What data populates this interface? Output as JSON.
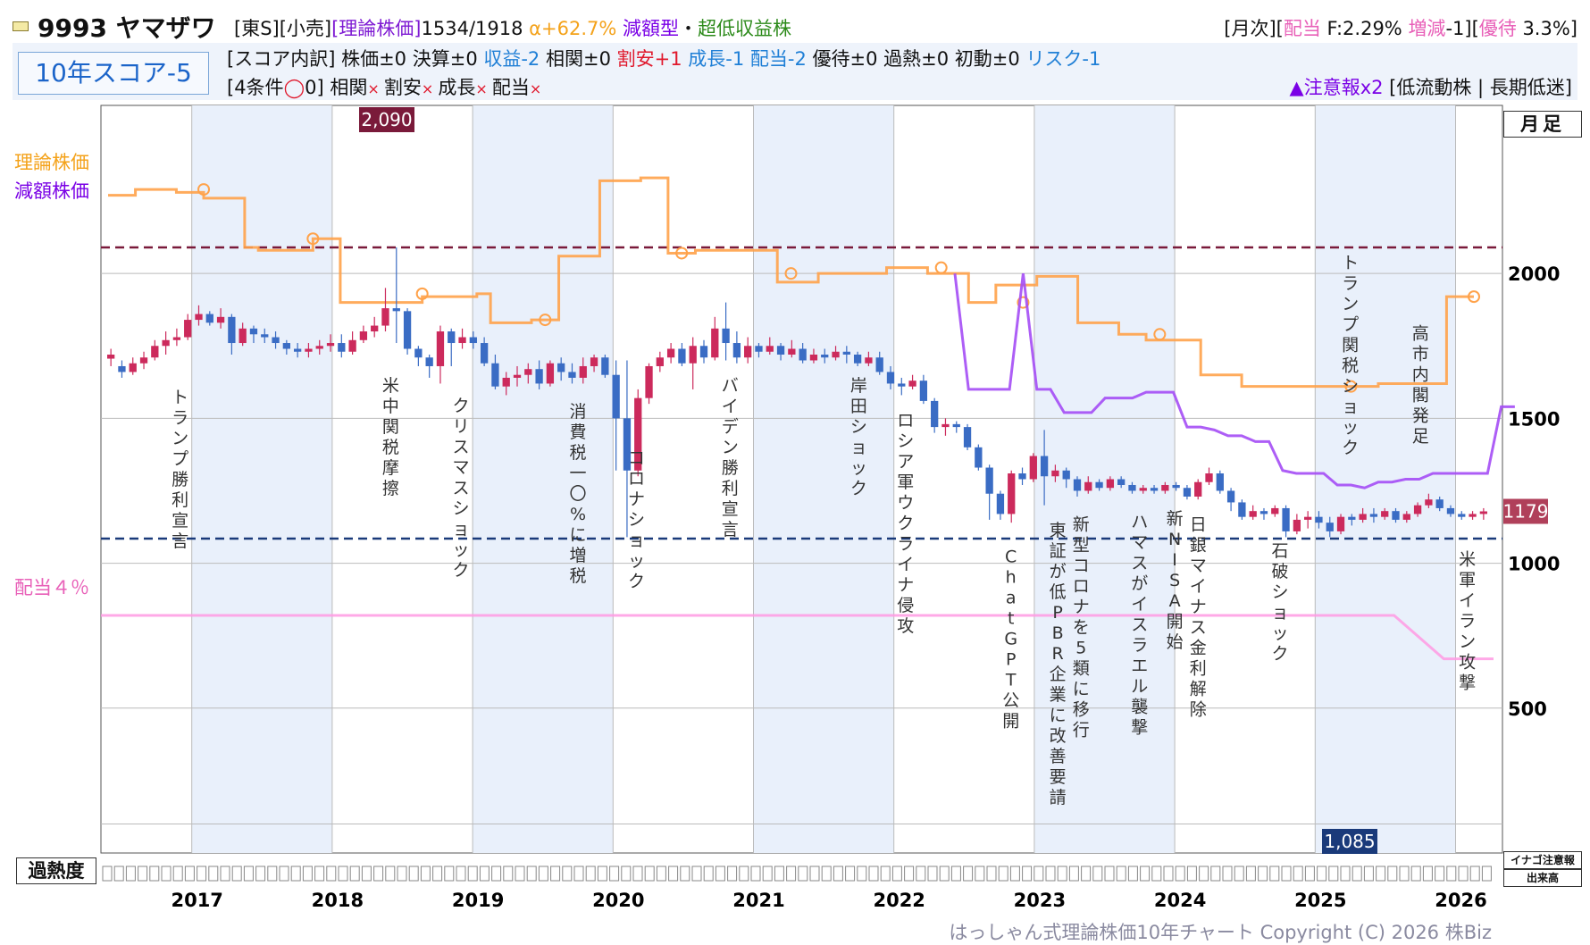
{
  "header": {
    "code_name": "9993 ヤマザワ",
    "market": "[東S][小売]",
    "theory_label": "[理論株価]",
    "theory_values": "1534/1918",
    "alpha": "α+62.7%",
    "type": "減額型",
    "dot": "・",
    "class": "超低収益株",
    "right_prefix": "[月次][",
    "right_div_label": "配当",
    "right_div_val": " F:2.29% ",
    "right_chg_label": "増減",
    "right_chg_val": "-1][",
    "right_yutai_label": "優待",
    "right_yutai_val": " 3.3%]"
  },
  "score": {
    "box": "10年スコア-5",
    "breakdown_label": "[スコア内訳]",
    "items": [
      {
        "label": "株価±0",
        "color": "normal"
      },
      {
        "label": "決算±0",
        "color": "normal"
      },
      {
        "label": "収益-2",
        "color": "blue"
      },
      {
        "label": "相関±0",
        "color": "normal"
      },
      {
        "label": "割安+1",
        "color": "red"
      },
      {
        "label": "成長-1",
        "color": "blue"
      },
      {
        "label": "配当-2",
        "color": "blue"
      },
      {
        "label": "優待±0",
        "color": "normal"
      },
      {
        "label": "過熱±0",
        "color": "normal"
      },
      {
        "label": "初動±0",
        "color": "normal"
      },
      {
        "label": "リスク-1",
        "color": "blue"
      }
    ],
    "conditions_prefix": "[4条件",
    "conditions_circle": "◯",
    "conditions_count": "0]",
    "conditions": [
      "相関",
      "割安",
      "成長",
      "配当"
    ],
    "cross": "×",
    "warn_mark": "▲注意報x2",
    "warn_detail": " [低流動株 | 長期低迷]"
  },
  "labels": {
    "theory": "理論株価",
    "gengaku": "減額株価",
    "dividend": "配当４％",
    "kanetsu": "過熱度",
    "getsuashi": "月足",
    "inago": "イナゴ注意報",
    "dekidaka": "出来高",
    "copyright": "はっしゃん式理論株価10年チャート Copyright (C) 2026 株Biz",
    "high_badge": "2,090",
    "low_badge": "1,085",
    "last_badge": "1179"
  },
  "colors": {
    "theory": "#ffa24a",
    "gengaku": "#a44df5",
    "dividend": "#ff9ae3",
    "up": "#cc2a5c",
    "down": "#3a6cc4",
    "high_line": "#7a1a3a",
    "low_line": "#1a3a7a",
    "band": "#e9f0fb"
  },
  "chart_data": {
    "type": "candlestick",
    "x_ticks": [
      "2017",
      "2018",
      "2019",
      "2020",
      "2021",
      "2022",
      "2023",
      "2024",
      "2025",
      "2026"
    ],
    "y_ticks": [
      500,
      1000,
      1500,
      2000
    ],
    "ylim": [
      0,
      2580
    ],
    "high": 2090,
    "low": 1085,
    "last": 1179,
    "candles": [
      [
        1706,
        1720,
        1680,
        1740
      ],
      [
        1680,
        1660,
        1640,
        1700
      ],
      [
        1660,
        1690,
        1650,
        1710
      ],
      [
        1690,
        1710,
        1670,
        1730
      ],
      [
        1710,
        1750,
        1700,
        1770
      ],
      [
        1750,
        1770,
        1720,
        1800
      ],
      [
        1770,
        1780,
        1750,
        1810
      ],
      [
        1780,
        1840,
        1770,
        1860
      ],
      [
        1840,
        1860,
        1820,
        1890
      ],
      [
        1860,
        1830,
        1820,
        1870
      ],
      [
        1830,
        1850,
        1810,
        1880
      ],
      [
        1850,
        1760,
        1720,
        1860
      ],
      [
        1760,
        1810,
        1750,
        1830
      ],
      [
        1810,
        1790,
        1760,
        1820
      ],
      [
        1790,
        1780,
        1760,
        1810
      ],
      [
        1780,
        1760,
        1740,
        1800
      ],
      [
        1760,
        1740,
        1720,
        1770
      ],
      [
        1740,
        1730,
        1710,
        1760
      ],
      [
        1730,
        1740,
        1710,
        1760
      ],
      [
        1740,
        1750,
        1720,
        1770
      ],
      [
        1750,
        1760,
        1730,
        1790
      ],
      [
        1760,
        1730,
        1710,
        1790
      ],
      [
        1730,
        1770,
        1720,
        1800
      ],
      [
        1770,
        1800,
        1760,
        1820
      ],
      [
        1800,
        1820,
        1780,
        1850
      ],
      [
        1820,
        1880,
        1800,
        1950
      ],
      [
        1880,
        1870,
        1760,
        2090
      ],
      [
        1870,
        1740,
        1720,
        1880
      ],
      [
        1740,
        1710,
        1680,
        1750
      ],
      [
        1710,
        1680,
        1640,
        1720
      ],
      [
        1680,
        1800,
        1620,
        1820
      ],
      [
        1800,
        1760,
        1680,
        1810
      ],
      [
        1760,
        1780,
        1740,
        1810
      ],
      [
        1780,
        1760,
        1740,
        1800
      ],
      [
        1760,
        1690,
        1680,
        1780
      ],
      [
        1690,
        1610,
        1600,
        1720
      ],
      [
        1610,
        1640,
        1580,
        1660
      ],
      [
        1640,
        1650,
        1610,
        1680
      ],
      [
        1650,
        1670,
        1620,
        1690
      ],
      [
        1670,
        1620,
        1600,
        1700
      ],
      [
        1620,
        1690,
        1610,
        1700
      ],
      [
        1690,
        1660,
        1630,
        1710
      ],
      [
        1660,
        1640,
        1620,
        1690
      ],
      [
        1640,
        1680,
        1620,
        1710
      ],
      [
        1680,
        1710,
        1660,
        1720
      ],
      [
        1710,
        1650,
        1640,
        1720
      ],
      [
        1650,
        1500,
        1320,
        1700
      ],
      [
        1500,
        1320,
        1090,
        1700
      ],
      [
        1320,
        1570,
        1300,
        1600
      ],
      [
        1570,
        1680,
        1550,
        1690
      ],
      [
        1680,
        1710,
        1660,
        1730
      ],
      [
        1710,
        1740,
        1690,
        1760
      ],
      [
        1740,
        1690,
        1680,
        1760
      ],
      [
        1690,
        1750,
        1600,
        1780
      ],
      [
        1750,
        1710,
        1690,
        1770
      ],
      [
        1710,
        1810,
        1700,
        1850
      ],
      [
        1810,
        1760,
        1700,
        1900
      ],
      [
        1760,
        1710,
        1690,
        1800
      ],
      [
        1710,
        1750,
        1690,
        1780
      ],
      [
        1750,
        1730,
        1710,
        1760
      ],
      [
        1730,
        1750,
        1720,
        1780
      ],
      [
        1750,
        1720,
        1700,
        1760
      ],
      [
        1720,
        1740,
        1710,
        1770
      ],
      [
        1740,
        1700,
        1690,
        1760
      ],
      [
        1700,
        1720,
        1690,
        1740
      ],
      [
        1720,
        1710,
        1690,
        1740
      ],
      [
        1710,
        1730,
        1700,
        1750
      ],
      [
        1730,
        1720,
        1690,
        1750
      ],
      [
        1720,
        1690,
        1680,
        1730
      ],
      [
        1690,
        1710,
        1680,
        1730
      ],
      [
        1710,
        1660,
        1650,
        1730
      ],
      [
        1660,
        1620,
        1600,
        1680
      ],
      [
        1620,
        1610,
        1580,
        1640
      ],
      [
        1610,
        1630,
        1600,
        1650
      ],
      [
        1630,
        1560,
        1550,
        1650
      ],
      [
        1560,
        1470,
        1450,
        1570
      ],
      [
        1470,
        1480,
        1440,
        1500
      ],
      [
        1480,
        1470,
        1450,
        1490
      ],
      [
        1470,
        1400,
        1390,
        1480
      ],
      [
        1400,
        1330,
        1320,
        1410
      ],
      [
        1330,
        1240,
        1150,
        1340
      ],
      [
        1240,
        1170,
        1150,
        1250
      ],
      [
        1170,
        1310,
        1140,
        1320
      ],
      [
        1310,
        1290,
        1270,
        1330
      ],
      [
        1290,
        1370,
        1280,
        1380
      ],
      [
        1370,
        1300,
        1200,
        1460
      ],
      [
        1300,
        1320,
        1280,
        1340
      ],
      [
        1320,
        1290,
        1260,
        1330
      ],
      [
        1290,
        1250,
        1230,
        1300
      ],
      [
        1250,
        1280,
        1240,
        1300
      ],
      [
        1280,
        1260,
        1250,
        1290
      ],
      [
        1260,
        1290,
        1250,
        1300
      ],
      [
        1290,
        1270,
        1260,
        1300
      ],
      [
        1270,
        1250,
        1240,
        1280
      ],
      [
        1250,
        1260,
        1240,
        1270
      ],
      [
        1260,
        1250,
        1240,
        1270
      ],
      [
        1250,
        1270,
        1240,
        1280
      ],
      [
        1270,
        1260,
        1250,
        1280
      ],
      [
        1260,
        1230,
        1220,
        1270
      ],
      [
        1230,
        1280,
        1220,
        1290
      ],
      [
        1280,
        1310,
        1270,
        1330
      ],
      [
        1310,
        1250,
        1240,
        1320
      ],
      [
        1250,
        1210,
        1180,
        1260
      ],
      [
        1210,
        1160,
        1150,
        1220
      ],
      [
        1160,
        1180,
        1150,
        1200
      ],
      [
        1180,
        1170,
        1150,
        1190
      ],
      [
        1170,
        1190,
        1160,
        1200
      ],
      [
        1190,
        1110,
        1090,
        1200
      ],
      [
        1110,
        1150,
        1100,
        1170
      ],
      [
        1150,
        1160,
        1120,
        1180
      ],
      [
        1160,
        1140,
        1120,
        1180
      ],
      [
        1140,
        1110,
        1090,
        1160
      ],
      [
        1110,
        1160,
        1100,
        1170
      ],
      [
        1160,
        1150,
        1130,
        1170
      ],
      [
        1150,
        1170,
        1140,
        1190
      ],
      [
        1170,
        1160,
        1140,
        1190
      ],
      [
        1160,
        1180,
        1150,
        1190
      ],
      [
        1180,
        1150,
        1140,
        1190
      ],
      [
        1150,
        1170,
        1140,
        1180
      ],
      [
        1170,
        1200,
        1160,
        1210
      ],
      [
        1200,
        1220,
        1190,
        1240
      ],
      [
        1220,
        1190,
        1180,
        1230
      ],
      [
        1190,
        1170,
        1160,
        1200
      ],
      [
        1170,
        1160,
        1150,
        1180
      ],
      [
        1160,
        1170,
        1150,
        1180
      ],
      [
        1170,
        1179,
        1150,
        1190
      ]
    ],
    "theory_series": [
      2270,
      2270,
      2290,
      2290,
      2290,
      2280,
      2280,
      2260,
      2260,
      2260,
      2090,
      2080,
      2080,
      2080,
      2080,
      2120,
      2120,
      1900,
      1900,
      1900,
      1900,
      1900,
      1900,
      1920,
      1920,
      1920,
      1920,
      1930,
      1830,
      1830,
      1830,
      1840,
      1840,
      2060,
      2060,
      2060,
      2320,
      2320,
      2320,
      2330,
      2330,
      2070,
      2070,
      2080,
      2080,
      2080,
      2080,
      2080,
      2080,
      1970,
      1970,
      1970,
      2000,
      2000,
      2000,
      2000,
      2000,
      2020,
      2020,
      2020,
      2000,
      2000,
      2000,
      1900,
      1900,
      1960,
      1960,
      1960,
      1990,
      1990,
      1990,
      1830,
      1830,
      1830,
      1790,
      1790,
      1770,
      1770,
      1770,
      1770,
      1650,
      1650,
      1650,
      1610,
      1610,
      1610,
      1610,
      1610,
      1610,
      1610,
      1610,
      1610,
      1610,
      1620,
      1620,
      1620,
      1620,
      1620,
      1920,
      1920,
      1920
    ],
    "gengaku_series_start": 62,
    "gengaku_series": [
      2000,
      1600,
      1600,
      1600,
      1600,
      2000,
      1600,
      1600,
      1520,
      1520,
      1520,
      1570,
      1570,
      1570,
      1590,
      1590,
      1590,
      1470,
      1470,
      1460,
      1440,
      1440,
      1420,
      1420,
      1320,
      1310,
      1310,
      1310,
      1270,
      1270,
      1260,
      1280,
      1280,
      1290,
      1290,
      1310,
      1310,
      1310,
      1310,
      1310,
      1540,
      1540
    ],
    "dividend_series": [
      820,
      820,
      820,
      820,
      820,
      820,
      820,
      820,
      820,
      820,
      820,
      820,
      820,
      820,
      820,
      820,
      820,
      820,
      820,
      820,
      820,
      820,
      820,
      820,
      820,
      820,
      820,
      670,
      670
    ],
    "circle_markers": [
      [
        8,
        2290
      ],
      [
        17,
        2120
      ],
      [
        27,
        1930
      ],
      [
        38,
        1840
      ],
      [
        49,
        2070
      ],
      [
        59,
        2000
      ],
      [
        71,
        2020
      ],
      [
        78,
        1900
      ],
      [
        90,
        1790
      ],
      [
        106,
        1610
      ],
      [
        117,
        1920
      ]
    ],
    "events": [
      {
        "text": "トランプ勝利宣言",
        "x": "2016-12",
        "y": 1640,
        "align": "top"
      },
      {
        "text": "米中関税摩擦",
        "x": "2018-06",
        "y": 1680,
        "align": "top"
      },
      {
        "text": "クリスマスショック",
        "x": "2018-12",
        "y": 1610,
        "align": "top"
      },
      {
        "text": "消費税一〇%に増税",
        "x": "2019-10",
        "y": 1590,
        "align": "top"
      },
      {
        "text": "コロナショック",
        "x": "2020-03",
        "y": 1430,
        "align": "top"
      },
      {
        "text": "バイデン勝利宣言",
        "x": "2020-11",
        "y": 1680,
        "align": "top"
      },
      {
        "text": "岸田ショック",
        "x": "2021-10",
        "y": 1680,
        "align": "top"
      },
      {
        "text": "ロシア軍ウクライナ侵攻",
        "x": "2022-02",
        "y": 1560,
        "align": "top"
      },
      {
        "text": "ChatGPT公開",
        "x": "2022-11",
        "y": 1090,
        "align": "top"
      },
      {
        "text": "東証が低PBR企業に改善要請",
        "x": "2023-03",
        "y": 1180,
        "align": "top"
      },
      {
        "text": "新型コロナを5類に移行",
        "x": "2023-05",
        "y": 1200,
        "align": "top"
      },
      {
        "text": "ハマスがイスラエル襲撃",
        "x": "2023-10",
        "y": 1210,
        "align": "top"
      },
      {
        "text": "新NISA開始",
        "x": "2024-01",
        "y": 1220,
        "align": "top"
      },
      {
        "text": "日銀マイナス金利解除",
        "x": "2024-03",
        "y": 1200,
        "align": "top"
      },
      {
        "text": "石破ショック",
        "x": "2024-10",
        "y": 1110,
        "align": "top"
      },
      {
        "text": "トランプ関税ショック",
        "x": "2025-04",
        "y": 1290,
        "align": "bottom"
      },
      {
        "text": "高市内閣発足",
        "x": "2025-10",
        "y": 1330,
        "align": "bottom"
      },
      {
        "text": "米軍イラン攻撃",
        "x": "2026-02",
        "y": 1080,
        "align": "top"
      }
    ]
  }
}
